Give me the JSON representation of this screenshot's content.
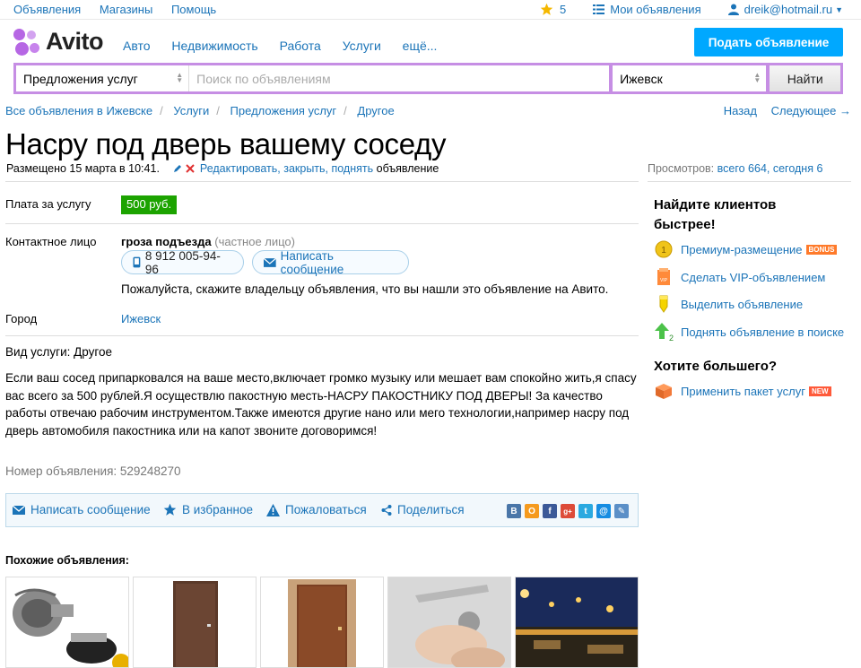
{
  "topbar": {
    "links": [
      "Объявления",
      "Магазины",
      "Помощь"
    ],
    "favorites_count": "5",
    "my_ads": "Мои объявления",
    "user_email": "dreik@hotmail.ru"
  },
  "header": {
    "logo": "Avito",
    "nav": [
      "Авто",
      "Недвижимость",
      "Работа",
      "Услуги",
      "ещё..."
    ],
    "post_button": "Подать объявление"
  },
  "search": {
    "category": "Предложения услуг",
    "placeholder": "Поиск по объявлениям",
    "city": "Ижевск",
    "button": "Найти"
  },
  "breadcrumbs": [
    "Все объявления в Ижевске",
    "Услуги",
    "Предложения услуг",
    "Другое"
  ],
  "pager": {
    "back": "Назад",
    "next": "Следующее →"
  },
  "ad": {
    "title": "Насру под дверь вашему соседу",
    "posted": "Размещено 15 марта в 10:41.",
    "edit_links": "Редактировать, закрыть, поднять",
    "edit_suffix": "объявление",
    "views_label": "Просмотров:",
    "views_value": "всего 664, сегодня 6",
    "price_label": "Плата за услугу",
    "price": "500 руб.",
    "contact_label": "Контактное лицо",
    "contact_name": "гроза подъезда",
    "contact_type": "(частное лицо)",
    "phone": "8 912 005-94-96",
    "write_message": "Написать сообщение",
    "notice": "Пожалуйста, скажите владельцу объявления, что вы нашли это объявление на Авито.",
    "city_label": "Город",
    "city": "Ижевск",
    "service_type": "Вид услуги: Другое",
    "description": "Если ваш сосед припарковался на ваше место,включает громко музыку или мешает вам спокойно жить,я спасу вас всего за 500 рублей.Я осуществлю пакостную месть-НАСРУ ПАКОСТНИКУ ПОД ДВЕРЫ! За качество работы отвечаю рабочим инструментом.Также имеются другие нано или мего технологии,например насру под дверь автомобиля пакостника или на капот звоните договоримся!",
    "ad_number": "Номер объявления: 529248270"
  },
  "actions": {
    "message": "Написать сообщение",
    "favorite": "В избранное",
    "complain": "Пожаловаться",
    "share": "Поделиться",
    "social": [
      "В",
      "О",
      "f",
      "g+",
      "t",
      "@",
      "✎"
    ]
  },
  "similar": {
    "title": "Похожие объявления:"
  },
  "sidebar": {
    "heading1_line1": "Найдите клиентов",
    "heading1_line2": "быстрее!",
    "items": [
      {
        "label": "Премиум-размещение",
        "tag": "BONUS"
      },
      {
        "label": "Сделать VIP-объявлением"
      },
      {
        "label": "Выделить объявление"
      },
      {
        "label": "Поднять объявление в поиске"
      }
    ],
    "heading2": "Хотите большего?",
    "package": {
      "label": "Применить пакет услуг",
      "tag": "NEW"
    }
  },
  "colors": {
    "link": "#1b74b8",
    "accent_purple": "#c68ee4",
    "price_green": "#1ca300",
    "post_blue": "#00a8ff"
  }
}
